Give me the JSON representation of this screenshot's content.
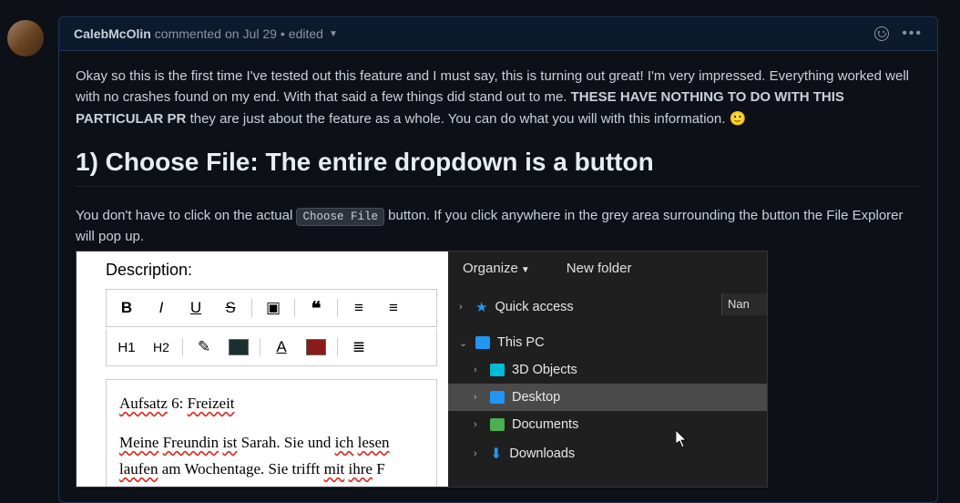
{
  "comment": {
    "author": "CalebMcOlin",
    "commented": " commented ",
    "date_prefix": "on ",
    "date": "Jul 29",
    "sep": " • ",
    "edited": "edited"
  },
  "body": {
    "p1_a": "Okay so this is the first time I've tested out this feature and I must say, this is turning out great! I'm very impressed. Everything worked well with no crashes found on my end. With that said a few things did stand out to me. ",
    "p1_bold": "THESE HAVE NOTHING TO DO WITH THIS PARTICULAR PR",
    "p1_b": " they are just about the feature as a whole. You can do what you will with this information. ",
    "emoji": "🙂",
    "h1": "1) Choose File: The entire dropdown is a button",
    "p2_a": "You don't have to click on the actual ",
    "code": "Choose File",
    "p2_b": " button. If you click anywhere in the grey area surrounding the button the File Explorer will pop up."
  },
  "editor": {
    "description_label": "Description:",
    "toolbar": {
      "b": "B",
      "i": "I",
      "u": "U",
      "s": "S",
      "h1": "H1",
      "h2": "H2"
    },
    "content": {
      "line1_a": "Aufsatz",
      "line1_b": " 6: ",
      "line1_c": "Freizeit",
      "line2_a": "Meine",
      "line2_b": " ",
      "line2_c": "Freundin",
      "line2_d": " ",
      "line2_e": "ist",
      "line2_f": " Sarah. Sie und ",
      "line2_g": "ich",
      "line2_h": " ",
      "line2_i": "lesen",
      "line3_a": "laufen",
      "line3_b": " am Wochentage. Sie trifft ",
      "line3_c": "mit",
      "line3_d": " ",
      "line3_e": "ihre",
      "line3_f": " F"
    }
  },
  "explorer": {
    "organize": "Organize",
    "new_folder": "New folder",
    "col_name": "Nan",
    "items": {
      "quick_access": "Quick access",
      "this_pc": "This PC",
      "3d": "3D Objects",
      "desktop": "Desktop",
      "documents": "Documents",
      "downloads": "Downloads"
    }
  }
}
